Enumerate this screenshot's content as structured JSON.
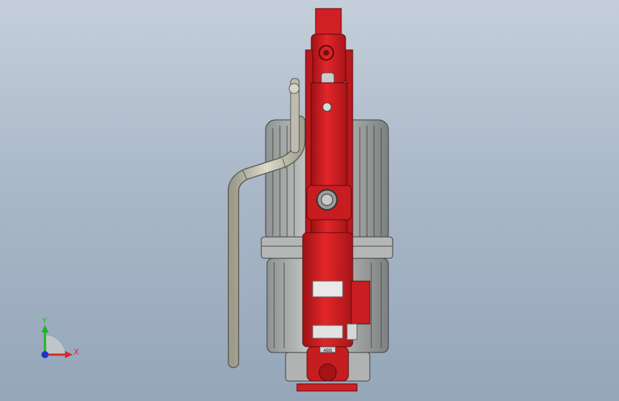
{
  "triad": {
    "y_label": "Y",
    "x_label": "X",
    "y_color": "#21b321",
    "x_color": "#d42a2a",
    "z_color": "#2233cc"
  },
  "model": {
    "primary_color": "#cf1f22",
    "secondary_color": "#a9acab",
    "hose_color": "#c9c7b6",
    "plate_text": "ABB"
  }
}
